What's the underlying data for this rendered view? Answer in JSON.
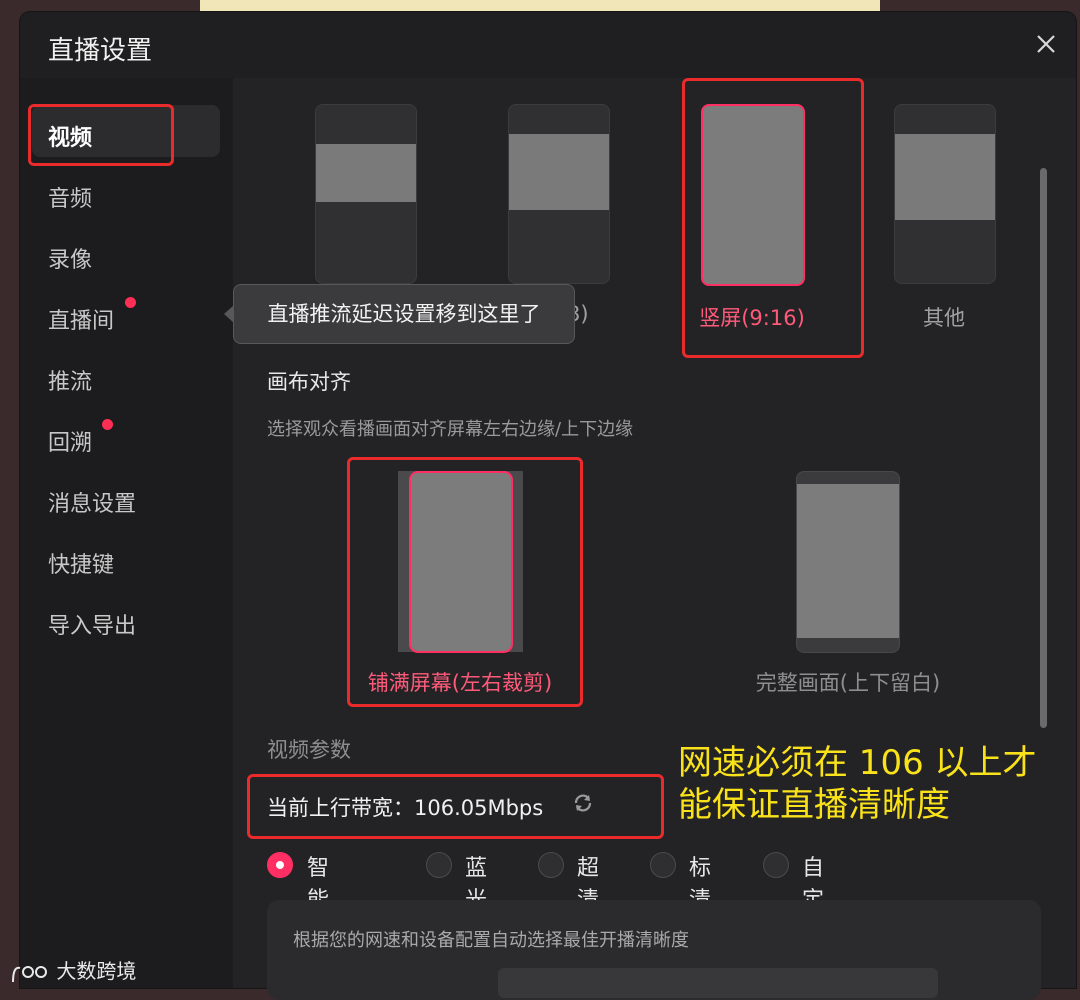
{
  "window": {
    "title": "直播设置"
  },
  "sidebar": {
    "items": [
      {
        "label": "视频",
        "active": true,
        "badge": false
      },
      {
        "label": "音频",
        "active": false,
        "badge": false
      },
      {
        "label": "录像",
        "active": false,
        "badge": false
      },
      {
        "label": "直播间",
        "active": false,
        "badge": true
      },
      {
        "label": "推流",
        "active": false,
        "badge": false
      },
      {
        "label": "回溯",
        "active": false,
        "badge": true
      },
      {
        "label": "消息设置",
        "active": false,
        "badge": false
      },
      {
        "label": "快捷键",
        "active": false,
        "badge": false
      },
      {
        "label": "导入导出",
        "active": false,
        "badge": false
      }
    ]
  },
  "tooltip": {
    "text": "直播推流延迟设置移到这里了"
  },
  "ratio": {
    "options": [
      {
        "label": "",
        "selected": false
      },
      {
        "label": ":3)",
        "selected": false
      },
      {
        "label": "竖屏(9:16)",
        "selected": true
      },
      {
        "label": "其他",
        "selected": false
      }
    ]
  },
  "canvas_align": {
    "title": "画布对齐",
    "desc": "选择观众看播画面对齐屏幕左右边缘/上下边缘",
    "options": [
      {
        "label": "铺满屏幕(左右裁剪)",
        "selected": true
      },
      {
        "label": "完整画面(上下留白)",
        "selected": false
      }
    ]
  },
  "video_params": {
    "title": "视频参数",
    "bandwidth": "当前上行带宽：106.05Mbps",
    "refresh_icon": "refresh-icon",
    "quality_options": [
      {
        "label": "智能推荐",
        "selected": true
      },
      {
        "label": "蓝光",
        "selected": false
      },
      {
        "label": "超清",
        "selected": false
      },
      {
        "label": "标清",
        "selected": false
      },
      {
        "label": "自定义",
        "selected": false
      }
    ],
    "quality_desc": "根据您的网速和设备配置自动选择最佳开播清晰度"
  },
  "annotation": {
    "line1": "网速必须在 106 以上才",
    "line2": "能保证直播清晰度"
  },
  "watermark": {
    "text": "大数跨境"
  },
  "colors": {
    "accent": "#ff2e63",
    "highlight_box": "#ea2b2b",
    "annotation": "#f9e21a"
  }
}
